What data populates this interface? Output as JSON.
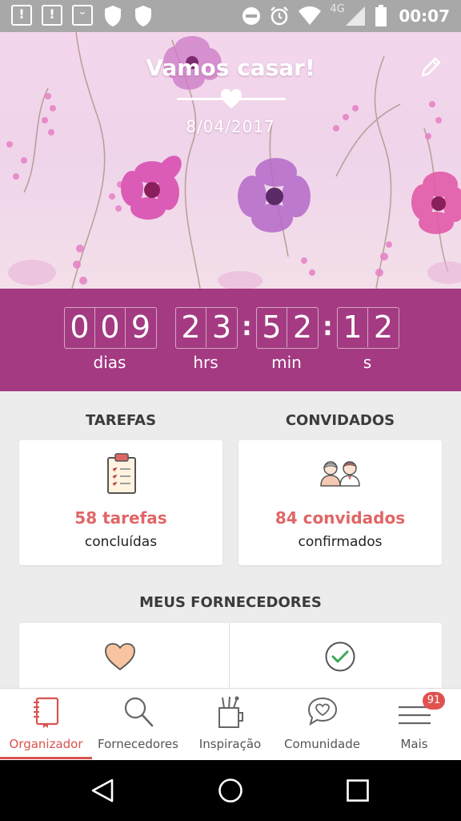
{
  "status_bar": {
    "time": "00:07",
    "network": "4G",
    "icons": [
      "alert-icon",
      "alert-icon",
      "face-icon",
      "shield-icon",
      "shield-icon",
      "dnd-icon",
      "alarm-icon",
      "wifi-icon",
      "signal-icon",
      "battery-icon"
    ]
  },
  "hero": {
    "title": "Vamos casar!",
    "date": "8/04/2017",
    "edit_icon": "pencil-icon"
  },
  "countdown": {
    "days_digits": [
      "0",
      "0",
      "9"
    ],
    "hours_digits": [
      "2",
      "3"
    ],
    "minutes_digits": [
      "5",
      "2"
    ],
    "seconds_digits": [
      "1",
      "2"
    ],
    "separator": ":",
    "labels": {
      "days": "dias",
      "hours": "hrs",
      "minutes": "min",
      "seconds": "s"
    }
  },
  "tasks": {
    "title": "TAREFAS",
    "value": "58 tarefas",
    "caption": "concluídas",
    "icon": "clipboard-icon"
  },
  "guests": {
    "title": "CONVIDADOS",
    "value": "84 convidados",
    "caption": "confirmados",
    "icon": "couple-icon"
  },
  "vendors": {
    "title": "MEUS FORNECEDORES",
    "left_icon": "heart-icon",
    "right_icon": "check-circle-icon"
  },
  "bottom_nav": {
    "items": [
      {
        "label": "Organizador",
        "icon": "notebook-icon",
        "active": true
      },
      {
        "label": "Fornecedores",
        "icon": "search-icon",
        "active": false
      },
      {
        "label": "Inspiração",
        "icon": "cup-icon",
        "active": false
      },
      {
        "label": "Comunidade",
        "icon": "chat-heart-icon",
        "active": false
      },
      {
        "label": "Mais",
        "icon": "menu-icon",
        "active": false,
        "badge": "91"
      }
    ]
  },
  "colors": {
    "accent": "#a43a82",
    "brand_red": "#e06666",
    "active_nav": "#d9534f",
    "background": "#ececec"
  }
}
